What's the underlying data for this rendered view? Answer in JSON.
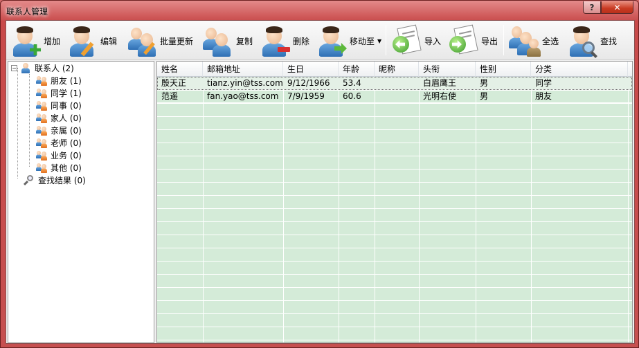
{
  "window": {
    "title": "联系人管理",
    "help": "?",
    "close": "✕"
  },
  "toolbar": {
    "add": "增加",
    "edit": "编辑",
    "batch_update": "批量更新",
    "copy": "复制",
    "delete": "删除",
    "move_to": "移动至",
    "import": "导入",
    "export": "导出",
    "select_all": "全选",
    "find": "查找"
  },
  "tree": {
    "root": "联系人 (2)",
    "groups": [
      {
        "label": "朋友 (1)"
      },
      {
        "label": "同学 (1)"
      },
      {
        "label": "同事 (0)"
      },
      {
        "label": "家人 (0)"
      },
      {
        "label": "亲属 (0)"
      },
      {
        "label": "老师 (0)"
      },
      {
        "label": "业务 (0)"
      },
      {
        "label": "其他 (0)"
      }
    ],
    "search_results": "查找结果 (0)"
  },
  "grid": {
    "columns": [
      "姓名",
      "邮箱地址",
      "生日",
      "年龄",
      "昵称",
      "头衔",
      "性别",
      "分类"
    ],
    "rows": [
      [
        "殷天正",
        "tianz.yin@tss.com",
        "9/12/1966",
        "53.4",
        "",
        "白眉鹰王",
        "男",
        "同学"
      ],
      [
        "范遥",
        "fan.yao@tss.com",
        "7/9/1959",
        "60.6",
        "",
        "光明右使",
        "男",
        "朋友"
      ]
    ]
  },
  "colors": {
    "title_bar": "#c84a4a",
    "grid_background": "#d4ebd8",
    "accent_blue": "#2e6fb4"
  }
}
